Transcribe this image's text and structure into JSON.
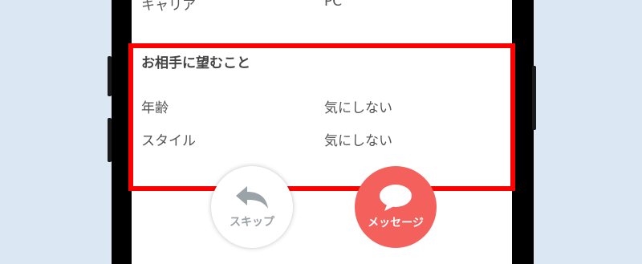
{
  "profile": {
    "top_row": {
      "label": "キャリア",
      "value": "PC"
    },
    "preferences_section": {
      "title": "お相手に望むこと",
      "rows": [
        {
          "label": "年齢",
          "value": "気にしない"
        },
        {
          "label": "スタイル",
          "value": "気にしない"
        }
      ]
    }
  },
  "actions": {
    "skip_label": "スキップ",
    "message_label": "メッセージ"
  },
  "colors": {
    "highlight_border": "#ff0000",
    "message_button": "#f4615c",
    "skip_icon": "#9aa3a8",
    "background": "#dbe7f3"
  },
  "icons": {
    "skip": "back-arrow-icon",
    "message": "speech-bubble-icon"
  }
}
